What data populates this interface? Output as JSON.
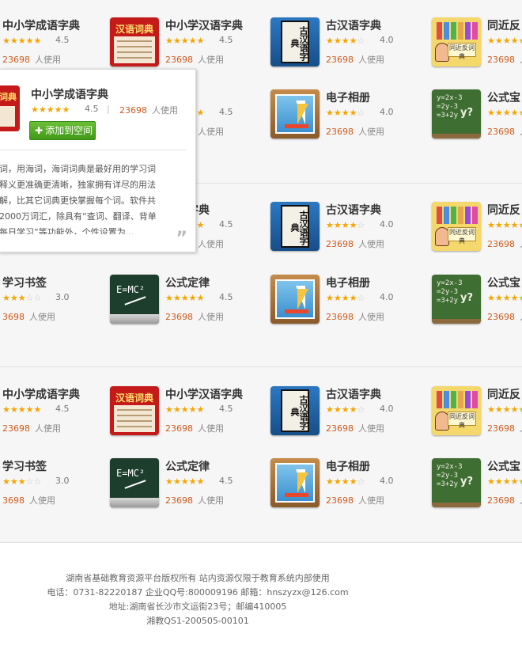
{
  "apps": {
    "chengyu": {
      "name": "中小学成语字典",
      "stars": "★★★★★",
      "off": "",
      "rating": "4.5",
      "count": "23698",
      "unit": "人使用"
    },
    "hanyu": {
      "name": "中小学汉语字典",
      "stars": "★★★★★",
      "off": "",
      "rating": "4.5",
      "count": "23698",
      "unit": "人使用"
    },
    "guhan": {
      "name": "古汉语字典",
      "stars": "★★★★",
      "off": "☆",
      "rating": "4.0",
      "count": "23698",
      "unit": "人使用"
    },
    "tongjin": {
      "name": "同近反",
      "stars": "★★★★★",
      "off": "",
      "count": "23698",
      "unit": "人"
    },
    "gongshi": {
      "name": "公式定律",
      "stars": "★★★★★",
      "off": "",
      "rating": "4.5",
      "count": "23698",
      "unit": "人使用"
    },
    "dianzi": {
      "name": "电子相册",
      "stars": "★★★★",
      "off": "☆",
      "rating": "4.0",
      "count": "23698",
      "unit": "人使用"
    },
    "gongshibao": {
      "name": "公式宝",
      "stars": "★★★★★",
      "off": "",
      "count": "23698",
      "unit": "人"
    },
    "xuexi": {
      "name": "学习书签",
      "stars": "★★★",
      "off": "☆☆",
      "rating": "3.0",
      "count": "3698",
      "unit": "人使用"
    },
    "gongshi_partial": {
      "name": "律",
      "stars": "★★★★★",
      "off": "",
      "rating": "4.5",
      "count": "23698",
      "unit": "人使用"
    },
    "hanyu_partial": {
      "name": "汉语字典",
      "stars": "★★★★★",
      "off": "",
      "rating": "4.5",
      "count": "23698",
      "unit": "人使用"
    }
  },
  "icons": {
    "red_title": "汉语词典",
    "blue_title": "古汉语字典",
    "yellow_board": "同近反词典",
    "emc": "E=MC²",
    "chalk": "y=2x-3\n=2y-3\n=3+2y",
    "chalk_q": "y?"
  },
  "popup": {
    "icon_text": "词典",
    "name": "中小学成语字典",
    "stars": "★★★★★",
    "rating": "4.5",
    "sep": "|",
    "count": "23698",
    "unit": "人使用",
    "add_button": "添加到空间",
    "description": "词，用海词，海词词典是最好用的学习词\n释义更准确更清晰，独家拥有详尽的用法\n解，比其它词典更快掌握每个词。软件共\n2000万词汇，除具有“查词、翻译、背单\n每日学习”等功能外，个性设置为...",
    "quote_mark": "”"
  },
  "footer": {
    "line1": "湖南省基础教育资源平台版权所有 站内资源仅限于教育系统内部使用",
    "line2": "电话：0731-82220187 企业QQ号:800009196 邮箱：hnszyzx@126.com",
    "line3": "地址:湖南省长沙市文运街23号；邮编410005",
    "line4": "湘教QS1-200505-00101"
  },
  "colors": {
    "accent_count": "#d05a1c",
    "star": "#f5a500",
    "button_green": "#4da823"
  }
}
